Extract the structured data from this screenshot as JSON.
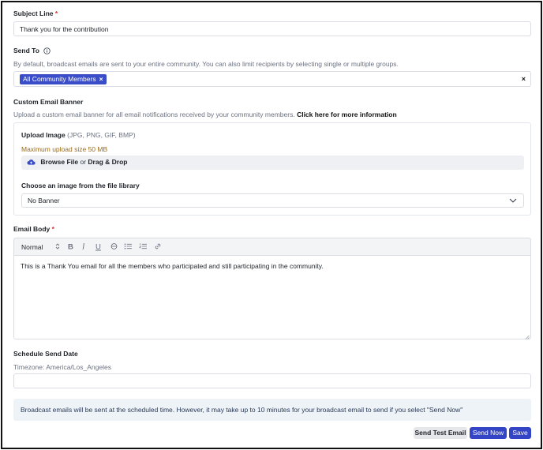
{
  "subject": {
    "label": "Subject Line",
    "required_mark": "*",
    "value": "Thank you for the contribution"
  },
  "send_to": {
    "label": "Send To",
    "info_icon": "info-circle-icon",
    "help": "By default, broadcast emails are sent to your entire community. You can also limit recipients by selecting single or multiple groups.",
    "chips": [
      {
        "label": "All Community Members",
        "remove": "×"
      }
    ],
    "clear": "×"
  },
  "banner": {
    "label": "Custom Email Banner",
    "help": "Upload a custom email banner for all email notifications received by your community members.",
    "link": "Click here for more information",
    "upload_label": "Upload Image",
    "upload_formats": "(JPG, PNG, GIF, BMP)",
    "max_size": "Maximum upload size 50 MB",
    "browse": "Browse File",
    "or": "or",
    "drag": "Drag & Drop",
    "library_label": "Choose an image from the file library",
    "library_value": "No Banner"
  },
  "body": {
    "label": "Email Body",
    "required_mark": "*",
    "format_value": "Normal",
    "toolbar_icons": [
      "bold-icon",
      "italic-icon",
      "underline-icon",
      "strikethrough-icon",
      "bullet-list-icon",
      "numbered-list-icon",
      "link-icon"
    ],
    "text": "This is a Thank You email for all the members who participated and still participating in the community."
  },
  "schedule": {
    "label": "Schedule Send Date",
    "timezone": "Timezone: America/Los_Angeles",
    "value": ""
  },
  "notice": "Broadcast emails will be sent at the scheduled time. However, it may take up to 10 minutes for your broadcast email to send if you select \"Send Now\"",
  "actions": {
    "test": "Send Test Email",
    "send_now": "Send Now",
    "save": "Save"
  },
  "colors": {
    "accent": "#3344c4",
    "chip": "#3a4dc9",
    "required": "#d0342c",
    "warning": "#9a6a18",
    "notice_bg": "#eef3f8"
  }
}
